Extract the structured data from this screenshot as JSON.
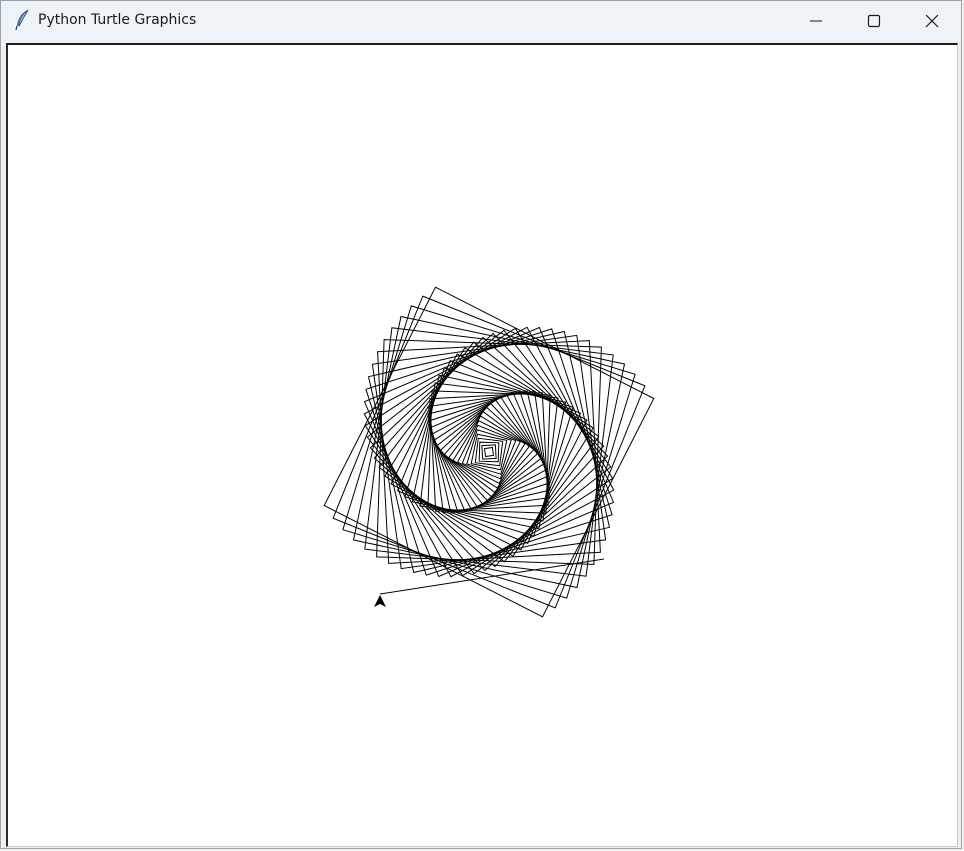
{
  "window": {
    "title": "Python Turtle Graphics",
    "controls": {
      "minimize": "minimize-icon",
      "maximize": "maximize-icon",
      "close": "close-icon"
    }
  },
  "canvas": {
    "background_color": "#ffffff",
    "pen_color": "#000000",
    "drawing": "spiral of rotated squares",
    "turtle_shape": "classic arrow cursor"
  }
}
